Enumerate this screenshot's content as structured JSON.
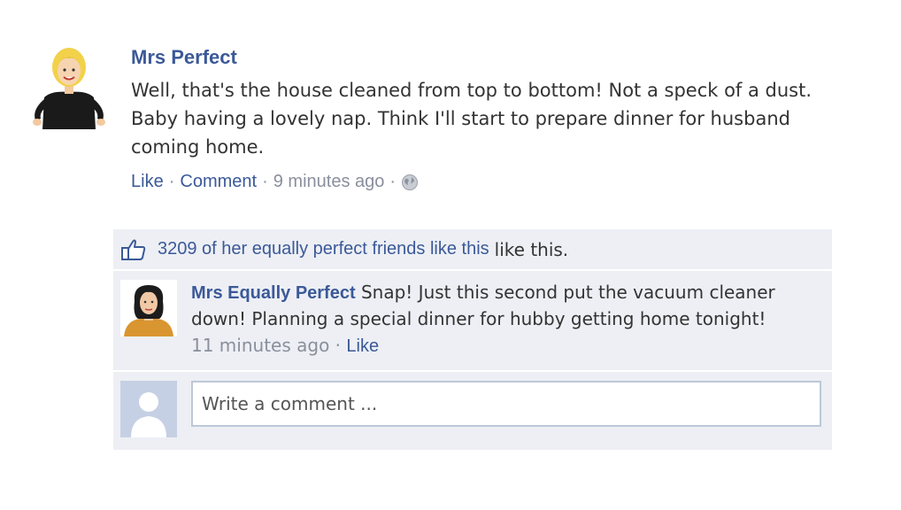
{
  "post": {
    "author": "Mrs Perfect",
    "text": "Well, that's the house cleaned from top to bottom! Not a speck of a dust. Baby having a lovely nap. Think I'll start to prepare dinner for husband coming home.",
    "like_label": "Like",
    "comment_label": "Comment",
    "timestamp": "9 minutes ago",
    "separator": "·"
  },
  "likes": {
    "link_text": "3209 of her equally perfect friends like this",
    "tail_text": "like this."
  },
  "comment": {
    "author": "Mrs Equally Perfect",
    "text": "Snap! Just this second put the vacuum cleaner down! Planning a special dinner for hubby getting home tonight!",
    "timestamp": "11 minutes ago",
    "like_label": "Like",
    "separator": "·"
  },
  "composer": {
    "placeholder": "Write a comment ..."
  },
  "colors": {
    "link": "#3b5998",
    "muted": "#898f9c",
    "panel": "#edeff4"
  },
  "icons": [
    "avatar-mrs-perfect",
    "globe-icon",
    "thumbs-up-icon",
    "avatar-mrs-equally-perfect",
    "default-avatar"
  ]
}
